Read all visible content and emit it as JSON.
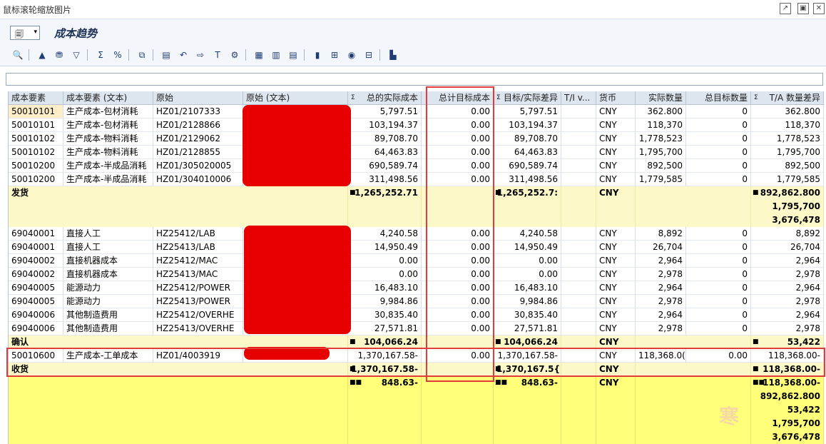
{
  "window": {
    "title": "鼠标滚轮缩放图片"
  },
  "app": {
    "title": "成本趋势"
  },
  "columns": [
    "成本要素",
    "成本要素 (文本)",
    "原始",
    "原始 (文本)",
    "总的实际成本",
    "总计目标成本",
    "目标/实际差异",
    "T/I v...",
    "货币",
    "实际数量",
    "总目标数量",
    "T/A 数量差异"
  ],
  "sigma": "Σ",
  "rows1": [
    [
      "50010101",
      "生产成本-包材消耗",
      "HZ01/2107333",
      "",
      "5,797.51",
      "0.00",
      "5,797.51",
      "",
      "CNY",
      "362.800",
      "0",
      "362.800"
    ],
    [
      "50010101",
      "生产成本-包材消耗",
      "HZ01/2128866",
      "",
      "103,194.37",
      "0.00",
      "103,194.37",
      "",
      "CNY",
      "118,370",
      "0",
      "118,370"
    ],
    [
      "50010102",
      "生产成本-物料消耗",
      "HZ01/2129062",
      "",
      "89,708.70",
      "0.00",
      "89,708.70",
      "",
      "CNY",
      "1,778,523",
      "0",
      "1,778,523"
    ],
    [
      "50010102",
      "生产成本-物料消耗",
      "HZ01/2128855",
      "",
      "64,463.83",
      "0.00",
      "64,463.83",
      "",
      "CNY",
      "1,795,700",
      "0",
      "1,795,700"
    ],
    [
      "50010200",
      "生产成本-半成品消耗",
      "HZ01/305020005",
      "",
      "690,589.74",
      "0.00",
      "690,589.74",
      "",
      "CNY",
      "892,500",
      "0",
      "892,500"
    ],
    [
      "50010200",
      "生产成本-半成品消耗",
      "HZ01/304010006",
      "",
      "311,498.56",
      "0.00",
      "311,498.56",
      "",
      "CNY",
      "1,779,585",
      "0",
      "1,779,585"
    ]
  ],
  "sum1": {
    "label": "发货",
    "actual": "1,265,252.71",
    "diff": "1,265,252.7:",
    "curr": "CNY",
    "qty": [
      "892,862.800",
      "1,795,700",
      "3,676,478"
    ]
  },
  "rows2": [
    [
      "69040001",
      "直接人工",
      "HZ25412/LAB",
      "",
      "4,240.58",
      "0.00",
      "4,240.58",
      "",
      "CNY",
      "8,892",
      "0",
      "8,892"
    ],
    [
      "69040001",
      "直接人工",
      "HZ25413/LAB",
      "",
      "14,950.49",
      "0.00",
      "14,950.49",
      "",
      "CNY",
      "26,704",
      "0",
      "26,704"
    ],
    [
      "69040002",
      "直接机器成本",
      "HZ25412/MAC",
      "",
      "0.00",
      "0.00",
      "0.00",
      "",
      "CNY",
      "2,964",
      "0",
      "2,964"
    ],
    [
      "69040002",
      "直接机器成本",
      "HZ25413/MAC",
      "",
      "0.00",
      "0.00",
      "0.00",
      "",
      "CNY",
      "2,978",
      "0",
      "2,978"
    ],
    [
      "69040005",
      "能源动力",
      "HZ25412/POWER",
      "",
      "16,483.10",
      "0.00",
      "16,483.10",
      "",
      "CNY",
      "2,964",
      "0",
      "2,964"
    ],
    [
      "69040005",
      "能源动力",
      "HZ25413/POWER",
      "",
      "9,984.86",
      "0.00",
      "9,984.86",
      "",
      "CNY",
      "2,978",
      "0",
      "2,978"
    ],
    [
      "69040006",
      "其他制造费用",
      "HZ25412/OVERHE",
      "",
      "30,835.40",
      "0.00",
      "30,835.40",
      "",
      "CNY",
      "2,964",
      "0",
      "2,964"
    ],
    [
      "69040006",
      "其他制造费用",
      "HZ25413/OVERHE",
      "",
      "27,571.81",
      "0.00",
      "27,571.81",
      "",
      "CNY",
      "2,978",
      "0",
      "2,978"
    ]
  ],
  "sum2": {
    "label": "确认",
    "actual": "104,066.24",
    "diff": "104,066.24",
    "curr": "CNY",
    "qty": "53,422"
  },
  "row3": [
    "50010600",
    "生产成本-工单成本",
    "HZ01/4003919",
    "",
    "1,370,167.58-",
    "0.00",
    "1,370,167.58-",
    "",
    "CNY",
    "118,368.0(",
    "0.00",
    "118,368.00-"
  ],
  "sum3": {
    "label": "收货",
    "actual": "1,370,167.58-",
    "diff": "1,370,167.5{",
    "curr": "CNY",
    "qty": "118,368.00-"
  },
  "total": {
    "actual": "848.63-",
    "diff": "848.63-",
    "curr": "CNY",
    "qty": [
      "118,368.00-",
      "892,862.800",
      "53,422",
      "1,795,700",
      "3,676,478"
    ]
  },
  "watermark": "寒"
}
